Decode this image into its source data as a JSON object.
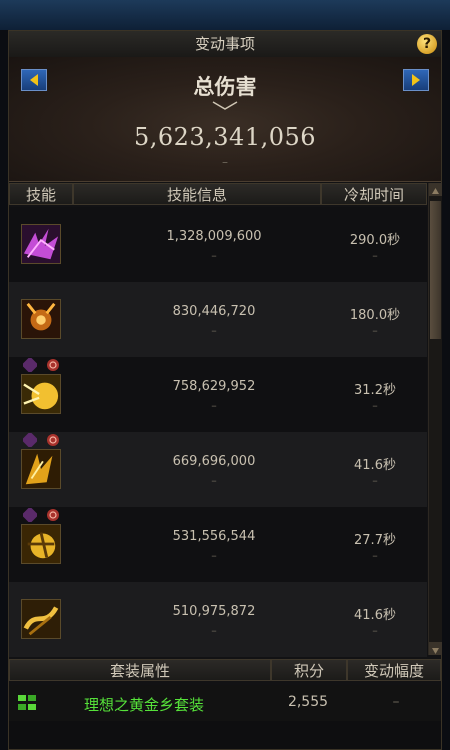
{
  "window": {
    "title": "变动事项",
    "help_label": "?"
  },
  "summary": {
    "label": "总伤害",
    "value": "5,623,341,056",
    "change": "–"
  },
  "table": {
    "columns": [
      "技能",
      "技能信息",
      "冷却时间"
    ],
    "rows": [
      {
        "icon": "skill-1-icon",
        "damage": "1,328,009,600",
        "cooldown": "290.0秒",
        "dmg_change": "–",
        "cd_change": "–"
      },
      {
        "icon": "skill-2-icon",
        "damage": "830,446,720",
        "cooldown": "180.0秒",
        "dmg_change": "–",
        "cd_change": "–"
      },
      {
        "icon": "skill-3-icon",
        "damage": "758,629,952",
        "cooldown": "31.2秒",
        "dmg_change": "–",
        "cd_change": "–"
      },
      {
        "icon": "skill-4-icon",
        "damage": "669,696,000",
        "cooldown": "41.6秒",
        "dmg_change": "–",
        "cd_change": "–"
      },
      {
        "icon": "skill-5-icon",
        "damage": "531,556,544",
        "cooldown": "27.7秒",
        "dmg_change": "–",
        "cd_change": "–"
      },
      {
        "icon": "skill-6-icon",
        "damage": "510,975,872",
        "cooldown": "41.6秒",
        "dmg_change": "–",
        "cd_change": "–"
      }
    ]
  },
  "set_table": {
    "columns": [
      "套装属性",
      "积分",
      "变动幅度"
    ],
    "row": {
      "icon": "set-icon",
      "name": "理想之黄金乡套装",
      "score": "2,555",
      "change": "–"
    }
  },
  "colors": {
    "set_name": "#56e23a",
    "nav_arrow": "#2f67b8",
    "help": "#f0b020"
  }
}
